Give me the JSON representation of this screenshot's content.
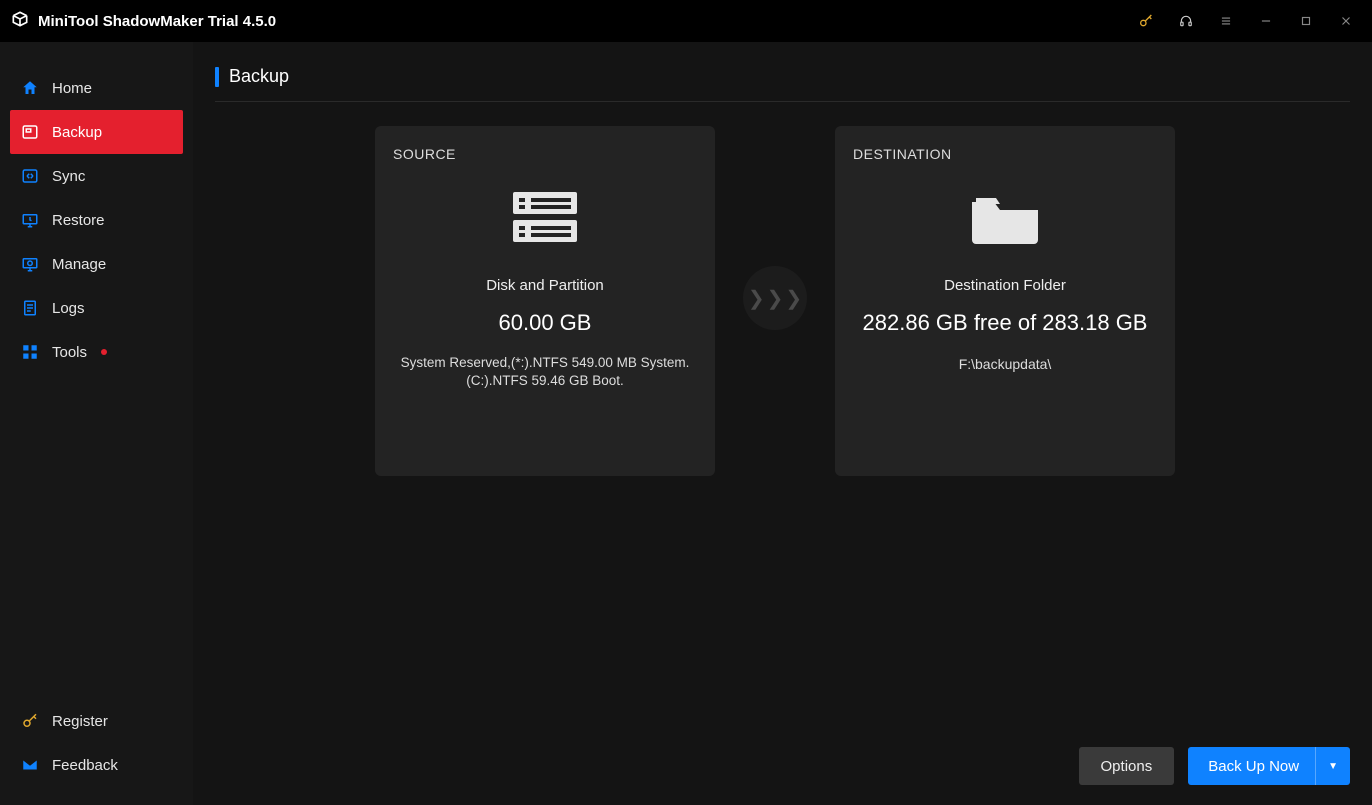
{
  "titlebar": {
    "title": "MiniTool ShadowMaker Trial 4.5.0",
    "icons": {
      "key": "key-icon",
      "headset": "headset-icon",
      "menu": "menu-icon",
      "min": "minimize-icon",
      "max": "maximize-icon",
      "close": "close-icon"
    }
  },
  "sidebar": {
    "items": [
      {
        "label": "Home"
      },
      {
        "label": "Backup"
      },
      {
        "label": "Sync"
      },
      {
        "label": "Restore"
      },
      {
        "label": "Manage"
      },
      {
        "label": "Logs"
      },
      {
        "label": "Tools"
      }
    ],
    "bottom": [
      {
        "label": "Register"
      },
      {
        "label": "Feedback"
      }
    ],
    "active_index": 1,
    "tools_has_dot": true
  },
  "page": {
    "title": "Backup",
    "source": {
      "heading": "SOURCE",
      "label": "Disk and Partition",
      "size": "60.00 GB",
      "details": "System Reserved,(*:).NTFS 549.00 MB System.(C:).NTFS 59.46 GB Boot."
    },
    "destination": {
      "heading": "DESTINATION",
      "label": "Destination Folder",
      "free": "282.86 GB free of 283.18 GB",
      "path": "F:\\backupdata\\"
    },
    "buttons": {
      "options": "Options",
      "backup": "Back Up Now"
    }
  }
}
